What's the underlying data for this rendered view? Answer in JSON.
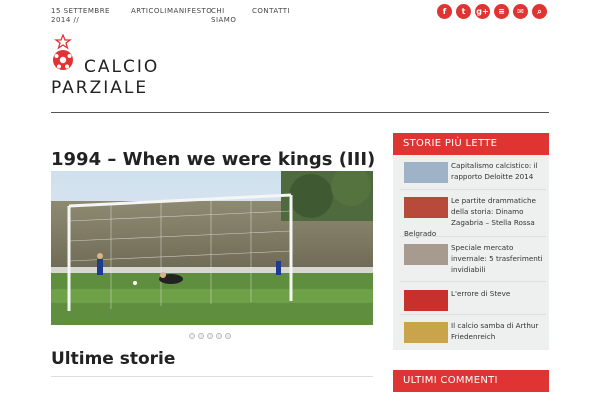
{
  "topbar": {
    "date": "15 SETTEMBRE 2014 //",
    "nav": [
      "ARTICOLI",
      "MANIFESTO",
      "CHI SIAMO",
      "CONTATTI"
    ]
  },
  "social_icons": [
    {
      "name": "facebook-icon",
      "glyph": "f"
    },
    {
      "name": "twitter-icon",
      "glyph": "t"
    },
    {
      "name": "googleplus-icon",
      "glyph": "g+"
    },
    {
      "name": "rss-icon",
      "glyph": "≡"
    },
    {
      "name": "email-icon",
      "glyph": "✉"
    },
    {
      "name": "search-icon",
      "glyph": "⌕"
    }
  ],
  "site": {
    "title_line1": "CALCIO",
    "title_line2": "PARZIALE",
    "accent": "#e03433"
  },
  "main": {
    "post_title": "1994 – When we were kings (III)",
    "section_title": "Ultime storie"
  },
  "sidebar": {
    "popular_title": "STORIE PIÙ LETTE",
    "comments_title": "ULTIMI COMMENTI",
    "stories": [
      {
        "title": "Capitalismo calcistico: il rapporto Deloitte 2014",
        "thumb": "#9fb3c8"
      },
      {
        "title": "Le partite drammatiche della storia: Dinamo Zagabria – Stella Rossa Belgrado",
        "thumb": "#b84a3c"
      },
      {
        "title": "Speciale mercato invernale: 5 trasferimenti invidiabili",
        "thumb": "#a79b8f"
      },
      {
        "title": "L'errore di Steve",
        "thumb": "#c8312b"
      },
      {
        "title": "Il calcio samba di Arthur Friedenreich",
        "thumb": "#c9a44a"
      }
    ]
  }
}
